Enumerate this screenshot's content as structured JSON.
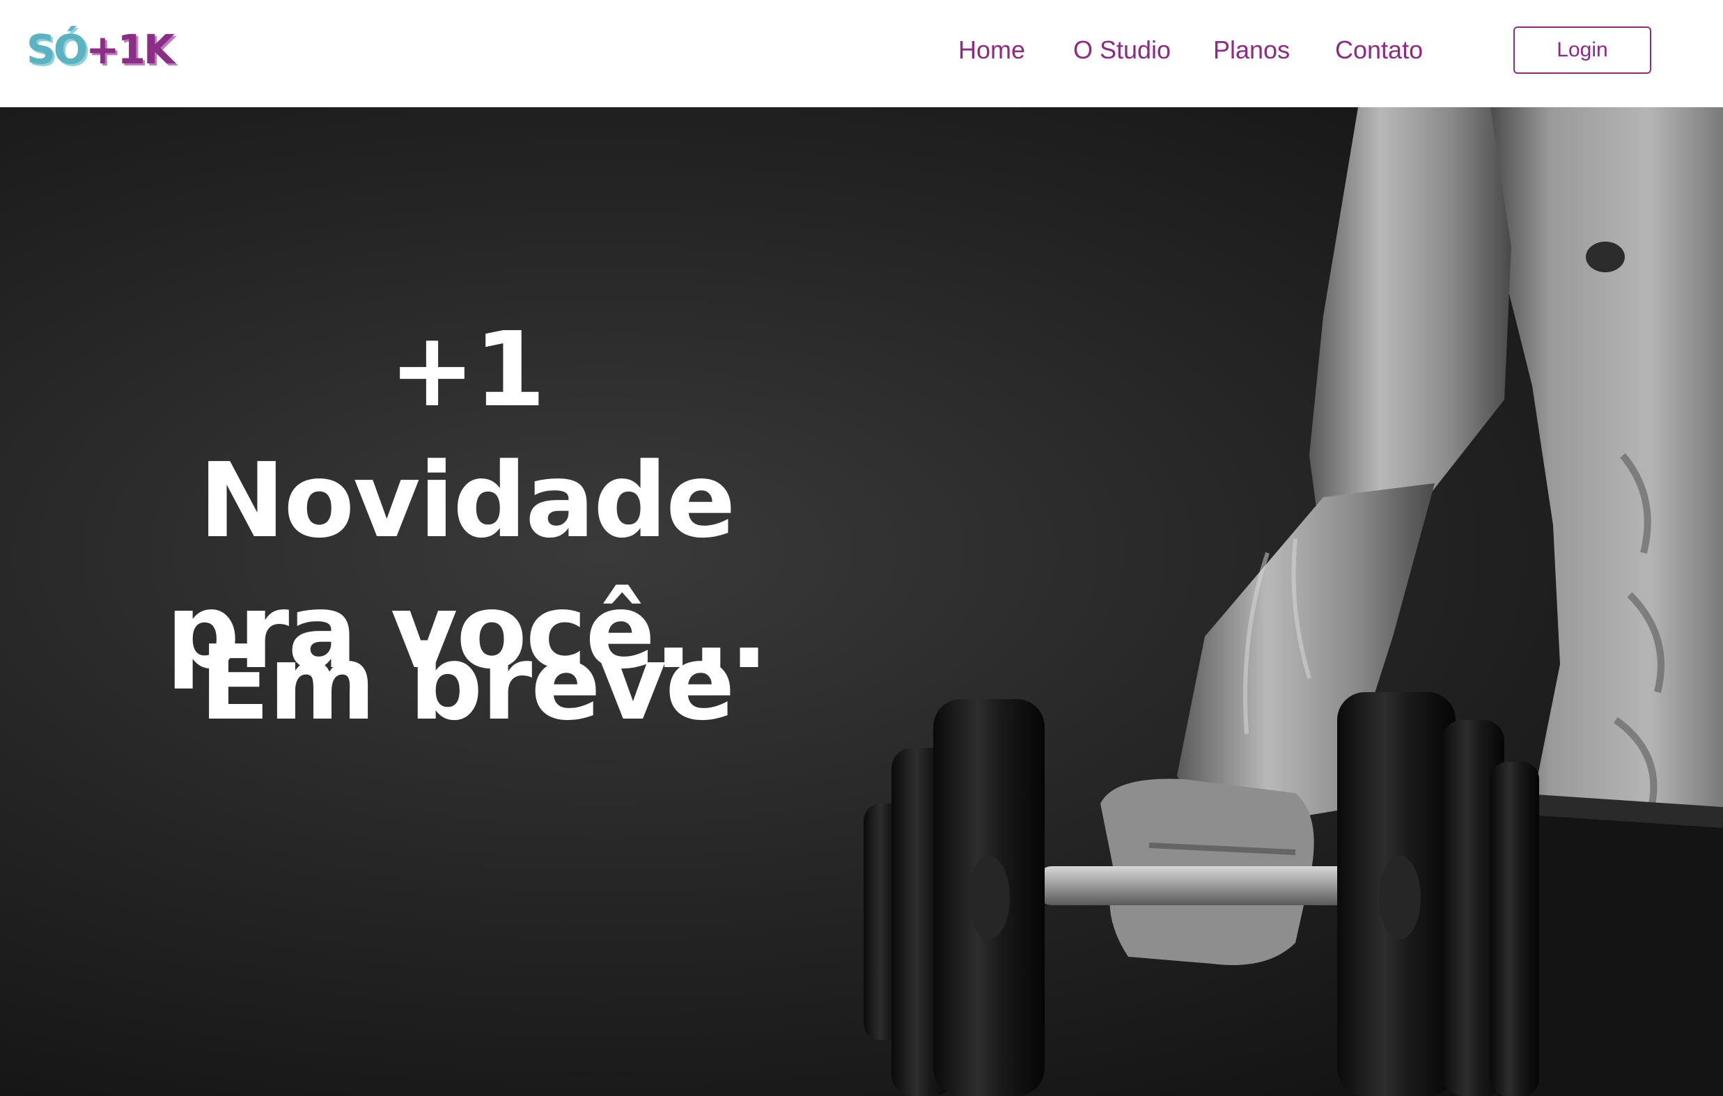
{
  "header": {
    "logo": {
      "part1": "SÓ",
      "part2": "+1K"
    },
    "nav": [
      {
        "label": "Home"
      },
      {
        "label": "O Studio"
      },
      {
        "label": "Planos"
      },
      {
        "label": "Contato"
      }
    ],
    "login_label": "Login"
  },
  "hero": {
    "headline_line1": "+1 Novidade",
    "headline_line2": "pra você...",
    "subline": "Em breve",
    "image_description_icon": "dumbbell-athlete-photo"
  },
  "colors": {
    "brand_purple": "#8c2a86",
    "brand_teal": "#5bb3c2",
    "hero_background": "#1c1c1c",
    "hero_text": "#ffffff"
  }
}
